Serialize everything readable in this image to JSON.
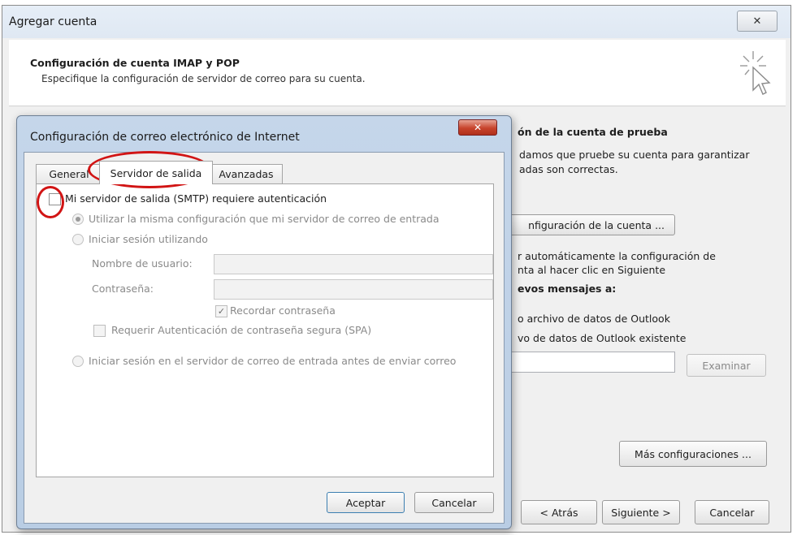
{
  "outer": {
    "title": "Agregar cuenta",
    "close_glyph": "✕",
    "header_title": "Configuración de cuenta IMAP y POP",
    "header_subtitle": "Especifique la configuración de servidor de correo para su cuenta.",
    "right": {
      "test_heading": "ón de la cuenta de prueba",
      "test_line1": "damos que pruebe su cuenta para garantizar",
      "test_line2": "adas son correctas.",
      "test_button": "nfiguración de la cuenta ...",
      "auto_line1": "r automáticamente la configuración de",
      "auto_line2": "nta al hacer clic en Siguiente",
      "deliver_heading": "evos mensajes a:",
      "new_file": "o archivo de datos de Outlook",
      "existing_file": "vo de datos de Outlook existente",
      "browse": "Examinar",
      "more_settings": "Más configuraciones ...",
      "back": "< Atrás",
      "next": "Siguiente >",
      "cancel": "Cancelar"
    }
  },
  "dialog": {
    "title": "Configuración de correo electrónico de Internet",
    "close_glyph": "✕",
    "tabs": [
      {
        "label": "General",
        "active": false
      },
      {
        "label": "Servidor de salida",
        "active": true
      },
      {
        "label": "Avanzadas",
        "active": false
      }
    ],
    "smtp_auth": {
      "label": "Mi servidor de salida (SMTP) requiere autenticación",
      "checked": false
    },
    "option_same": "Utilizar la misma configuración que mi servidor de correo de entrada",
    "option_login": "Iniciar sesión utilizando",
    "username_label": "Nombre de usuario:",
    "username_value": "",
    "password_label": "Contraseña:",
    "password_value": "",
    "remember_password": "Recordar contraseña",
    "remember_checkmark": "✓",
    "spa": "Requerir Autenticación de contraseña segura (SPA)",
    "option_pop_before": "Iniciar sesión en el servidor de correo de entrada antes de enviar correo",
    "ok": "Aceptar",
    "cancel": "Cancelar"
  },
  "colors": {
    "annotation": "#d11414",
    "dialog_frame": "#c5d6ea",
    "close_red": "#c7432b"
  },
  "icons": [
    "wizard-cursor-icon",
    "close-icon"
  ]
}
